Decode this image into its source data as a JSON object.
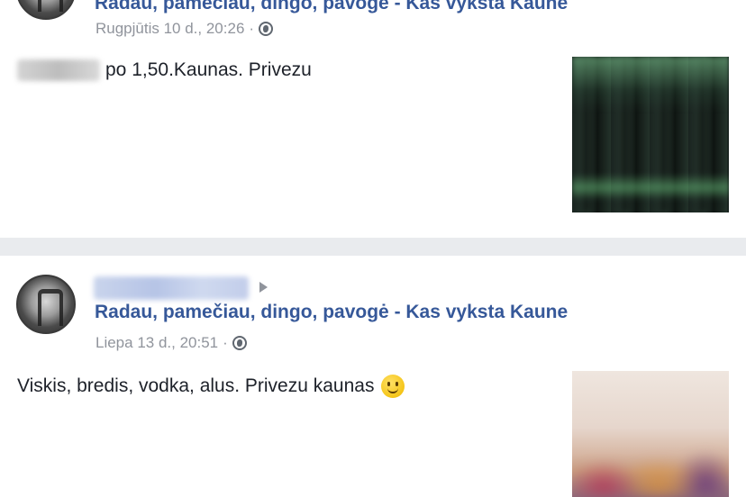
{
  "posts": [
    {
      "group_link": "Radau, pamečiau, dingo, pavogė - Kas vyksta Kaune",
      "timestamp": "Rugpjūtis 10 d., 20:26",
      "separator": "·",
      "privacy_icon": "globe-icon",
      "text": "po 1,50.Kaunas. Privezu",
      "photo": "blurred-bottles-photo"
    },
    {
      "group_link": "Radau, pamečiau, dingo, pavogė - Kas vyksta Kaune",
      "timestamp": "Liepa 13 d., 20:51",
      "separator": "·",
      "privacy_icon": "globe-icon",
      "text": "Viskis, bredis, vodka, alus. Privezu kaunas",
      "emoji": "slightly-smiling-face-icon",
      "photo": "blurred-photo"
    }
  ],
  "colors": {
    "link": "#365899",
    "meta": "#90949c",
    "text": "#1d2129",
    "divider": "#e9ebee"
  }
}
